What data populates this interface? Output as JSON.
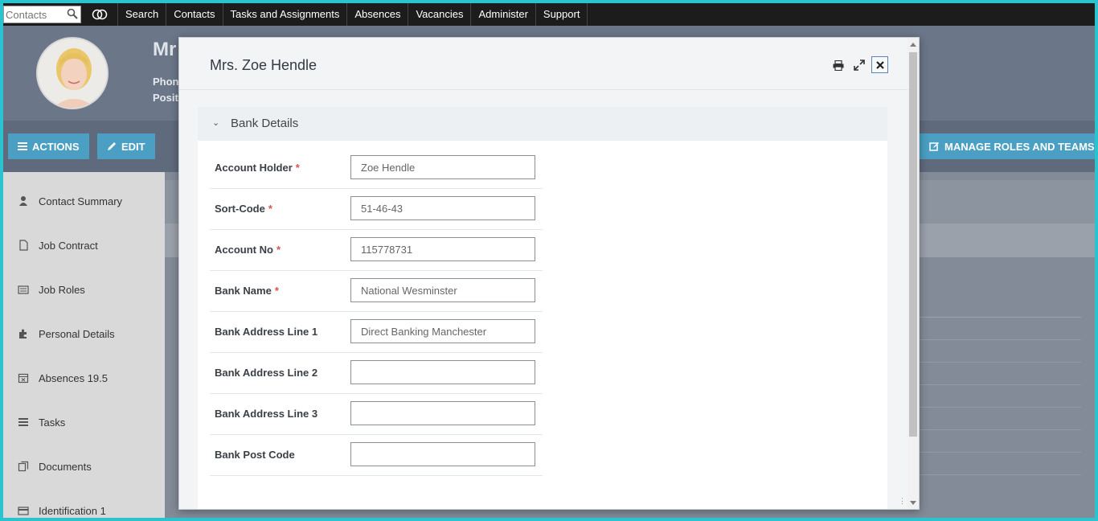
{
  "topnav": {
    "search_placeholder": "Contacts",
    "items": [
      "Search",
      "Contacts",
      "Tasks and Assignments",
      "Absences",
      "Vacancies",
      "Administer",
      "Support"
    ]
  },
  "header": {
    "name_partial": "Mr",
    "phone_label": "Phon",
    "position_label": "Posit"
  },
  "actions": {
    "actions_label": "ACTIONS",
    "edit_label": "EDIT",
    "manage_label": "MANAGE ROLES AND TEAMS"
  },
  "sidebar": {
    "items": [
      {
        "label": "Contact Summary",
        "icon": "person-icon"
      },
      {
        "label": "Job Contract",
        "icon": "file-icon"
      },
      {
        "label": "Job Roles",
        "icon": "card-icon"
      },
      {
        "label": "Personal Details",
        "icon": "puzzle-icon"
      },
      {
        "label": "Absences 19.5",
        "icon": "calendar-icon"
      },
      {
        "label": "Tasks",
        "icon": "list-icon"
      },
      {
        "label": "Documents",
        "icon": "documents-icon"
      },
      {
        "label": "Identification 1",
        "icon": "id-card-icon"
      }
    ]
  },
  "modal": {
    "title": "Mrs. Zoe Hendle",
    "section_title": "Bank Details",
    "fields": [
      {
        "label": "Account Holder",
        "required": "*",
        "value": "Zoe Hendle"
      },
      {
        "label": "Sort-Code",
        "required": "*",
        "value": "51-46-43"
      },
      {
        "label": "Account No",
        "required": "*",
        "value": "115778731"
      },
      {
        "label": "Bank Name",
        "required": "*",
        "value": "National Wesminster"
      },
      {
        "label": "Bank Address Line 1",
        "required": "",
        "value": "Direct Banking Manchester"
      },
      {
        "label": "Bank Address Line 2",
        "required": "",
        "value": ""
      },
      {
        "label": "Bank Address Line 3",
        "required": "",
        "value": ""
      },
      {
        "label": "Bank Post Code",
        "required": "",
        "value": ""
      }
    ]
  },
  "colors": {
    "accent_button": "#4a9fc2",
    "required_mark": "#d9534f",
    "frame_border": "#2ac3cf"
  }
}
